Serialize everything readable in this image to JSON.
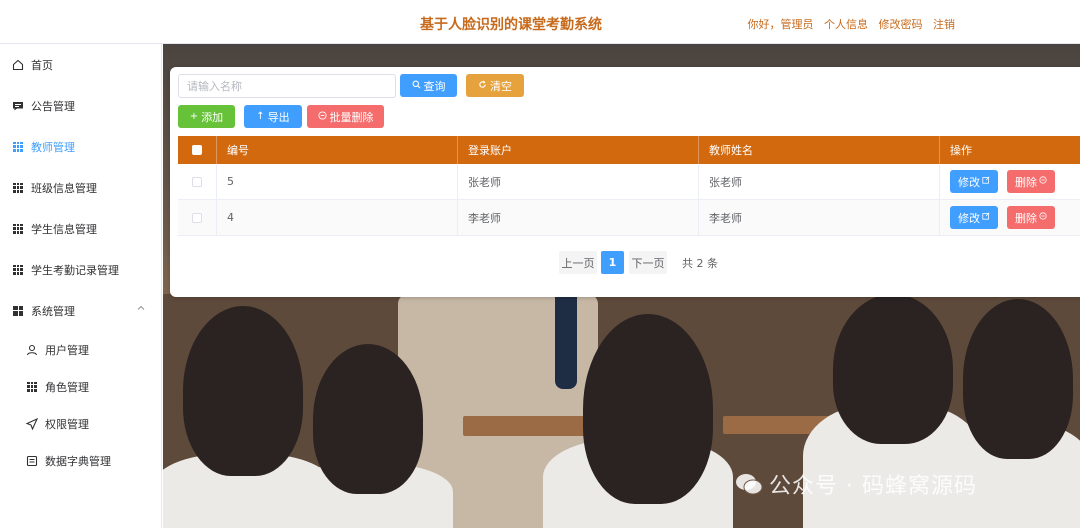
{
  "header": {
    "title": "基于人脸识别的课堂考勤系统",
    "greeting": "你好，管理员",
    "profile": "个人信息",
    "change_password": "修改密码",
    "logout": "注销"
  },
  "sidebar": {
    "items": [
      {
        "label": "首页",
        "icon": "home-icon"
      },
      {
        "label": "公告管理",
        "icon": "message-icon"
      },
      {
        "label": "教师管理",
        "icon": "grid-icon",
        "active": true
      },
      {
        "label": "班级信息管理",
        "icon": "grid-icon"
      },
      {
        "label": "学生信息管理",
        "icon": "grid-icon"
      },
      {
        "label": "学生考勤记录管理",
        "icon": "grid-icon"
      },
      {
        "label": "系统管理",
        "icon": "grid-icon",
        "expanded": true
      }
    ],
    "sub_items": [
      {
        "label": "用户管理",
        "icon": "user-icon"
      },
      {
        "label": "角色管理",
        "icon": "grid-icon"
      },
      {
        "label": "权限管理",
        "icon": "send-icon"
      },
      {
        "label": "数据字典管理",
        "icon": "dictionary-icon"
      }
    ]
  },
  "toolbar": {
    "search_placeholder": "请输入名称",
    "query": "查询",
    "clear": "清空",
    "add": "添加",
    "export": "导出",
    "batch_delete": "批量删除"
  },
  "table": {
    "columns": [
      "编号",
      "登录账户",
      "教师姓名",
      "操作"
    ],
    "rows": [
      {
        "id": "5",
        "account": "张老师",
        "name": "张老师"
      },
      {
        "id": "4",
        "account": "李老师",
        "name": "李老师"
      }
    ],
    "edit_label": "修改",
    "delete_label": "删除"
  },
  "pagination": {
    "prev": "上一页",
    "current": "1",
    "next": "下一页",
    "total": "共 2 条"
  },
  "watermark": "公众号 · 码蜂窝源码",
  "colors": {
    "accent": "#d2690e",
    "title": "#c76a1c",
    "primary": "#409eff",
    "warning": "#e6a23c",
    "success": "#67c23a",
    "danger": "#f56c6c"
  }
}
